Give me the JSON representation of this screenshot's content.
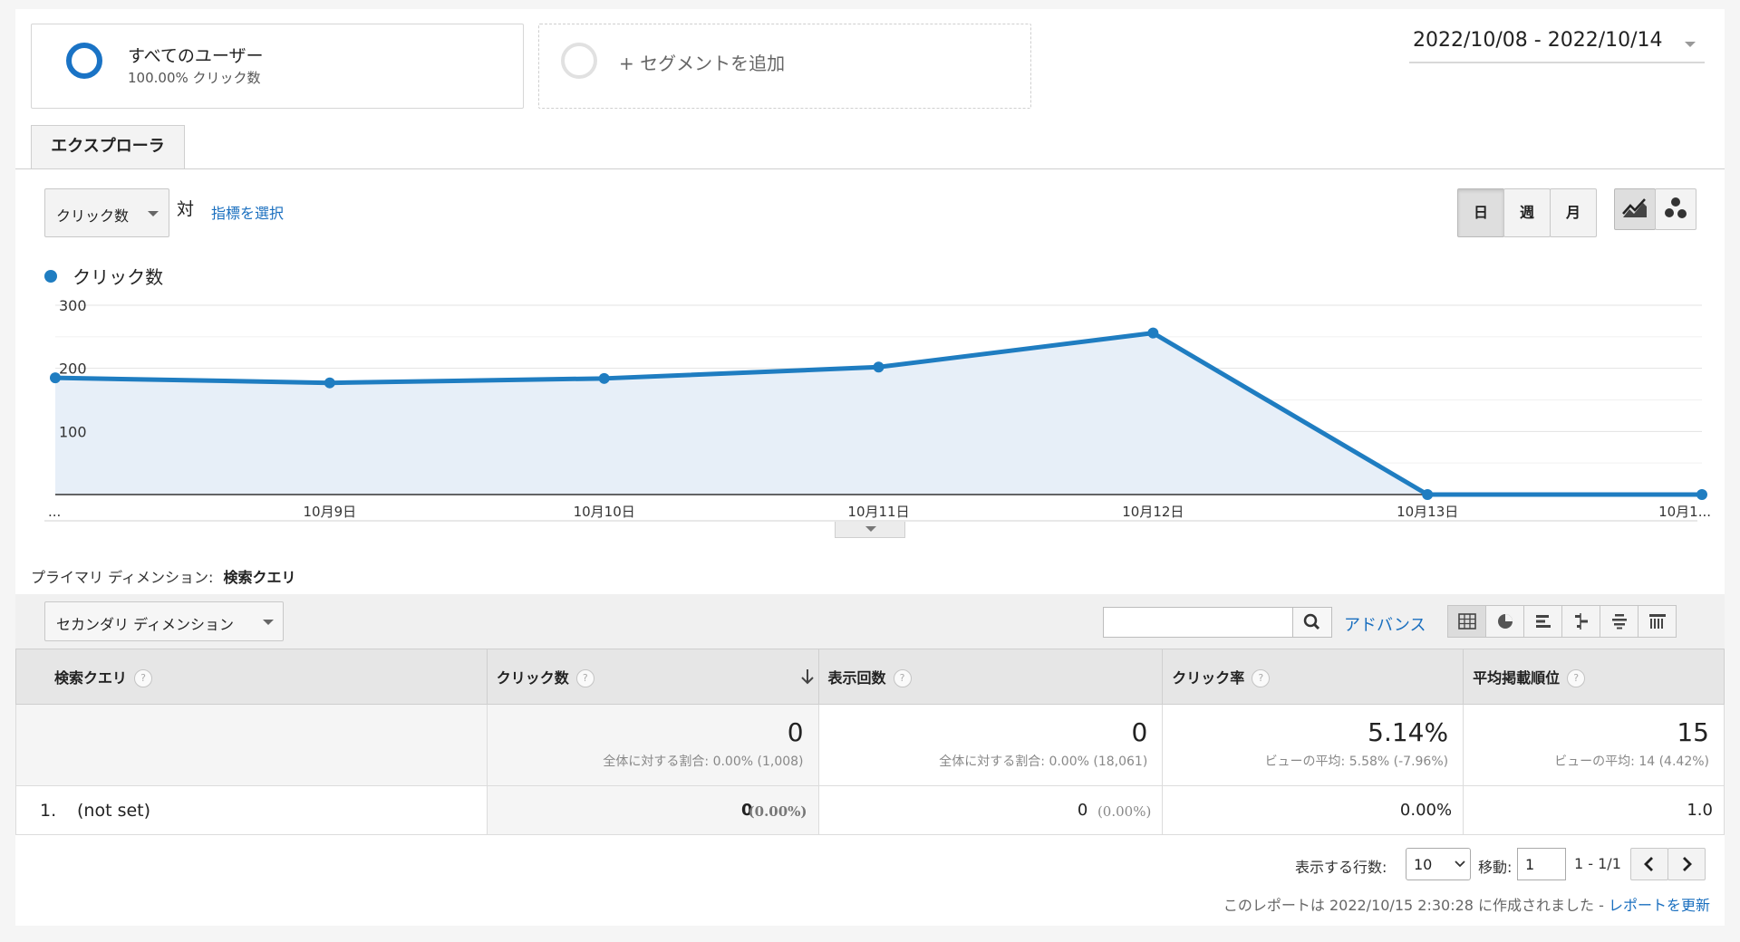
{
  "segments": {
    "all_users": {
      "title": "すべてのユーザー",
      "subtitle": "100.00% クリック数"
    },
    "add_segment": "+ セグメントを追加"
  },
  "date_range": "2022/10/08 - 2022/10/14",
  "tab": "エクスプローラ",
  "metric_select": "クリック数",
  "vs_label": "対",
  "choose_metric_link": "指標を選択",
  "period_buttons": [
    "日",
    "週",
    "月"
  ],
  "legend_label": "クリック数",
  "colors": {
    "series": "#1f7dc1",
    "area": "#e7eff8",
    "link": "#1a6fbf"
  },
  "chart_data": {
    "type": "area",
    "x": [
      "...",
      "10月9日",
      "10月10日",
      "10月11日",
      "10月12日",
      "10月13日",
      "10月1..."
    ],
    "series": [
      {
        "name": "クリック数",
        "values": [
          185,
          177,
          184,
          202,
          256,
          0,
          0
        ]
      }
    ],
    "yticks": [
      "300",
      "200",
      "100"
    ],
    "ylim": [
      0,
      300
    ],
    "grid": true
  },
  "primary_dimension": {
    "label": "プライマリ ディメンション:",
    "value": "検索クエリ"
  },
  "secondary_dimension": "セカンダリ ディメンション",
  "advanced_link": "アドバンス",
  "view_icons": [
    "table-view-icon",
    "pie-view-icon",
    "bar-view-icon",
    "comparison-view-icon",
    "term-cloud-icon",
    "pivot-view-icon"
  ],
  "table": {
    "headers": [
      "検索クエリ",
      "クリック数",
      "表示回数",
      "クリック率",
      "平均掲載順位"
    ],
    "totals": [
      {
        "value": "0",
        "sub": "全体に対する割合: 0.00% (1,008)"
      },
      {
        "value": "0",
        "sub": "全体に対する割合: 0.00% (18,061)"
      },
      {
        "value": "5.14%",
        "sub": "ビューの平均: 5.58% (-7.96%)"
      },
      {
        "value": "15",
        "sub": "ビューの平均: 14 (4.42%)"
      }
    ],
    "rows": [
      {
        "index": "1.",
        "query": "(not set)",
        "clicks": "0",
        "clicks_pct": "(0.00%)",
        "impressions": "0",
        "impressions_pct": "(0.00%)",
        "ctr": "0.00%",
        "position": "1.0"
      }
    ]
  },
  "pagination": {
    "rows_label": "表示する行数:",
    "rows_value": "10",
    "goto_label": "移動:",
    "goto_value": "1",
    "range": "1 - 1/1"
  },
  "footer": {
    "text": "このレポートは 2022/10/15 2:30:28 に作成されました - ",
    "refresh_link": "レポートを更新"
  }
}
